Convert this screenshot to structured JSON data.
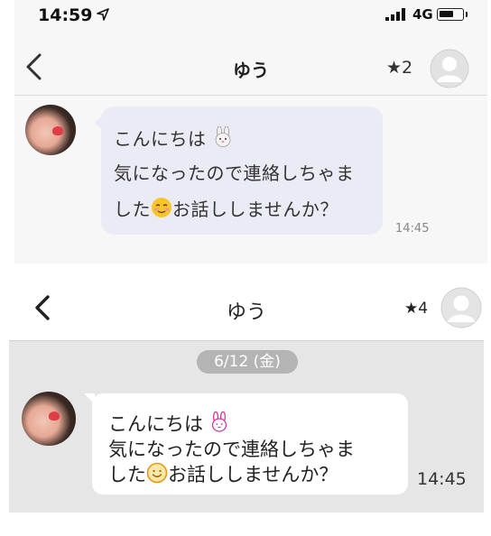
{
  "status_bar": {
    "time": "14:59",
    "network": "4G"
  },
  "screen1": {
    "header": {
      "title": "ゆう",
      "stars": "★2"
    },
    "message": {
      "lines": [
        "こんにちは",
        "気になったので連絡しちゃま",
        "した",
        "お話ししませんか？"
      ],
      "time": "14:45"
    }
  },
  "screen2": {
    "header": {
      "title": "ゆう",
      "stars": "★4"
    },
    "date_separator": "6/12 (金)",
    "message": {
      "lines": [
        "こんにちは",
        "気になったので連絡しちゃま",
        "した",
        "お話ししませんか？"
      ],
      "time": "14:45"
    }
  },
  "icons": {
    "back": "chevron-left-icon",
    "avatar_placeholder": "user-silhouette-icon",
    "rabbit": "rabbit-face-emoji",
    "smile": "smiling-face-emoji"
  },
  "colors": {
    "bubble_received_top": "#ebebf5",
    "bubble_received_bottom": "#ffffff",
    "chat_background_bottom": "#e6e6e6",
    "date_pill": "#b4b4b4"
  }
}
